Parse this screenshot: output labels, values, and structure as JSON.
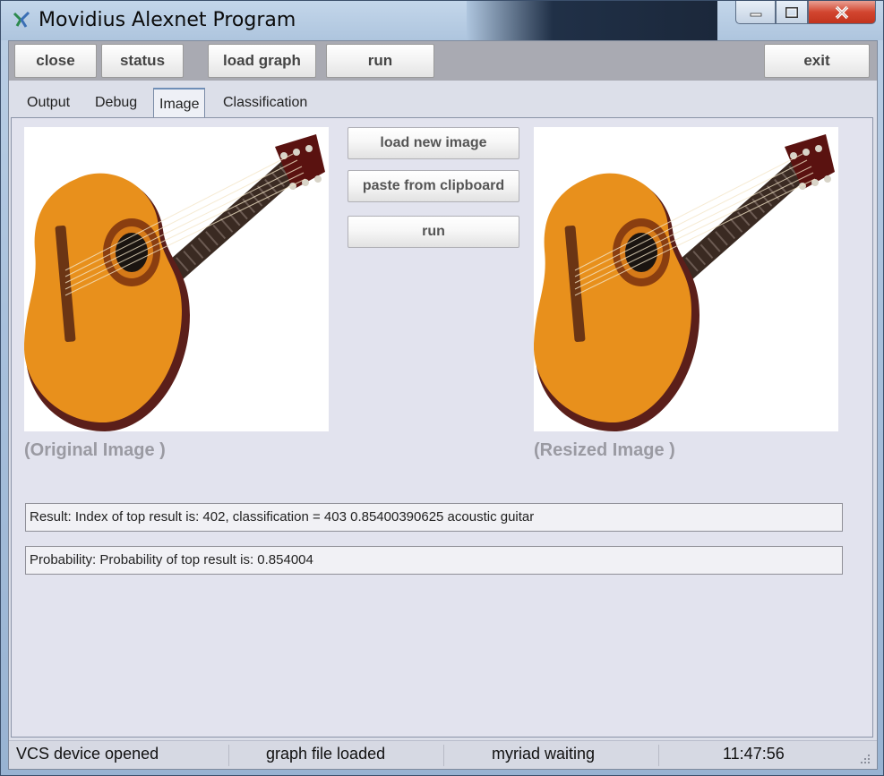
{
  "window": {
    "title": "Movidius Alexnet Program",
    "controls": {
      "minimize": "minimize-icon",
      "maximize": "maximize-icon",
      "close": "close-icon"
    }
  },
  "toolbar": {
    "close_label": "close",
    "status_label": "status",
    "load_graph_label": "load graph",
    "run_label": "run",
    "exit_label": "exit"
  },
  "tabs": [
    "Output",
    "Debug",
    "Image",
    "Classification"
  ],
  "active_tab": "Image",
  "image_panel": {
    "original_caption": "(Original Image )",
    "resized_caption": "(Resized Image )",
    "load_new_image_label": "load new image",
    "paste_label": "paste from clipboard",
    "run_label": "run"
  },
  "results": {
    "result_text": "Result: Index of top result is: 402, classification =  403 0.85400390625 acoustic guitar",
    "probability_text": "Probability: Probability of top result is: 0.854004"
  },
  "statusbar": {
    "device": "VCS device opened",
    "graph": "graph file loaded",
    "myriad": "myriad waiting",
    "time": "11:47:56"
  },
  "colors": {
    "accent": "#6f8fb8",
    "close_button": "#d2452f",
    "guitar_body": "#e8901c"
  }
}
